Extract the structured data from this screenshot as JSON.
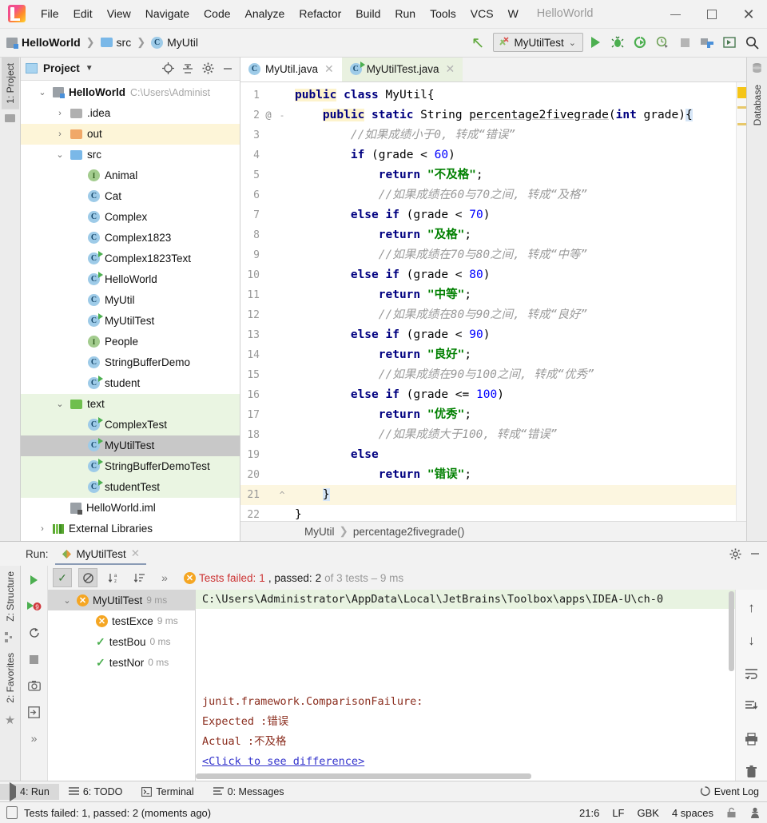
{
  "window": {
    "title": "HelloWorld",
    "minimize_label": "minimize",
    "maximize_label": "maximize",
    "close_label": "close"
  },
  "menubar": {
    "items": [
      "File",
      "Edit",
      "View",
      "Navigate",
      "Code",
      "Analyze",
      "Refactor",
      "Build",
      "Run",
      "Tools",
      "VCS",
      "W"
    ]
  },
  "navbar": {
    "breadcrumb": [
      "HelloWorld",
      "src",
      "MyUtil"
    ],
    "run_config": "MyUtilTest",
    "icons": [
      "back-arrow-icon",
      "run-icon",
      "debug-icon",
      "run-with-coverage-icon",
      "profile-icon",
      "stop-icon",
      "build-project-icon",
      "select-opened-file-icon",
      "search-everywhere-icon"
    ]
  },
  "left_rail": {
    "project_tab": "1: Project",
    "structure_tab": "Z: Structure",
    "favorites_tab": "2: Favorites"
  },
  "right_rail": {
    "database_tab": "Database"
  },
  "project_panel": {
    "title": "Project",
    "toolbar_icons": [
      "locate-icon",
      "collapse-all-icon",
      "gear-icon",
      "hide-icon"
    ],
    "tree": [
      {
        "depth": 0,
        "chev": "v",
        "icon": "project-folder-icon",
        "label": "HelloWorld",
        "bold": true,
        "path": "C:\\Users\\Administ",
        "hl": ""
      },
      {
        "depth": 1,
        "chev": ">",
        "icon": "folder-gray-icon",
        "label": ".idea",
        "bold": false,
        "path": "",
        "hl": ""
      },
      {
        "depth": 1,
        "chev": ">",
        "icon": "folder-orange-icon",
        "label": "out",
        "bold": false,
        "path": "",
        "hl": "yellow"
      },
      {
        "depth": 1,
        "chev": "v",
        "icon": "folder-blue-icon",
        "label": "src",
        "bold": false,
        "path": "",
        "hl": ""
      },
      {
        "depth": 2,
        "chev": "",
        "icon": "interface-icon",
        "label": "Animal",
        "bold": false,
        "path": "",
        "hl": ""
      },
      {
        "depth": 2,
        "chev": "",
        "icon": "class-icon",
        "label": "Cat",
        "bold": false,
        "path": "",
        "hl": ""
      },
      {
        "depth": 2,
        "chev": "",
        "icon": "class-icon",
        "label": "Complex",
        "bold": false,
        "path": "",
        "hl": ""
      },
      {
        "depth": 2,
        "chev": "",
        "icon": "class-icon",
        "label": "Complex1823",
        "bold": false,
        "path": "",
        "hl": ""
      },
      {
        "depth": 2,
        "chev": "",
        "icon": "class-runnable-icon",
        "label": "Complex1823Text",
        "bold": false,
        "path": "",
        "hl": ""
      },
      {
        "depth": 2,
        "chev": "",
        "icon": "class-runnable-icon",
        "label": "HelloWorld",
        "bold": false,
        "path": "",
        "hl": ""
      },
      {
        "depth": 2,
        "chev": "",
        "icon": "class-icon",
        "label": "MyUtil",
        "bold": false,
        "path": "",
        "hl": ""
      },
      {
        "depth": 2,
        "chev": "",
        "icon": "class-runnable-icon",
        "label": "MyUtilTest",
        "bold": false,
        "path": "",
        "hl": ""
      },
      {
        "depth": 2,
        "chev": "",
        "icon": "interface-icon",
        "label": "People",
        "bold": false,
        "path": "",
        "hl": ""
      },
      {
        "depth": 2,
        "chev": "",
        "icon": "class-icon",
        "label": "StringBufferDemo",
        "bold": false,
        "path": "",
        "hl": ""
      },
      {
        "depth": 2,
        "chev": "",
        "icon": "class-runnable-icon",
        "label": "student",
        "bold": false,
        "path": "",
        "hl": ""
      },
      {
        "depth": 1,
        "chev": "v",
        "icon": "folder-green-icon",
        "label": "text",
        "bold": false,
        "path": "",
        "hl": "green"
      },
      {
        "depth": 2,
        "chev": "",
        "icon": "class-test-icon",
        "label": "ComplexTest",
        "bold": false,
        "path": "",
        "hl": "green"
      },
      {
        "depth": 2,
        "chev": "",
        "icon": "class-test-icon",
        "label": "MyUtilTest",
        "bold": false,
        "path": "",
        "hl": "sel"
      },
      {
        "depth": 2,
        "chev": "",
        "icon": "class-test-icon",
        "label": "StringBufferDemoTest",
        "bold": false,
        "path": "",
        "hl": "green"
      },
      {
        "depth": 2,
        "chev": "",
        "icon": "class-test-icon",
        "label": "studentTest",
        "bold": false,
        "path": "",
        "hl": "green"
      },
      {
        "depth": 1,
        "chev": "",
        "icon": "iml-file-icon",
        "label": "HelloWorld.iml",
        "bold": false,
        "path": "",
        "hl": ""
      },
      {
        "depth": 0,
        "chev": ">",
        "icon": "library-icon",
        "label": "External Libraries",
        "bold": false,
        "path": "",
        "hl": ""
      }
    ]
  },
  "editor": {
    "tabs": [
      {
        "label": "MyUtil.java",
        "icon": "class-icon",
        "active": true
      },
      {
        "label": "MyUtilTest.java",
        "icon": "class-test-icon",
        "active": false
      }
    ],
    "breadcrumb": [
      "MyUtil",
      "percentage2fivegrade()"
    ],
    "lines": [
      {
        "n": "1",
        "mark": "",
        "fold": "",
        "cur": false,
        "html": "<span class=\"hl-kw kw\">public</span> <span class=\"kw\">class</span> <span class=\"plain\">MyUtil{</span>"
      },
      {
        "n": "2",
        "mark": "@",
        "fold": "-",
        "cur": false,
        "html": "    <span class=\"hl-kw kw\">public</span> <span class=\"kw\">static</span> <span class=\"plain\">String </span><span class=\"plain ul\">percentage2fivegrade</span><span class=\"plain\">(</span><span class=\"kw\">int</span><span class=\"plain\"> grade)</span><span class=\"brace-hl plain\">{</span>"
      },
      {
        "n": "3",
        "mark": "",
        "fold": "",
        "cur": false,
        "html": "        <span class=\"cmt\">//如果成绩小于0, 转成“错误”</span>"
      },
      {
        "n": "4",
        "mark": "",
        "fold": "",
        "cur": false,
        "html": "        <span class=\"kw\">if</span><span class=\"plain\"> (grade &lt; </span><span class=\"num\">60</span><span class=\"plain\">)</span>"
      },
      {
        "n": "5",
        "mark": "",
        "fold": "",
        "cur": false,
        "html": "            <span class=\"kw\">return</span> <span class=\"str\">\"不及格\"</span><span class=\"plain\">;</span>"
      },
      {
        "n": "6",
        "mark": "",
        "fold": "",
        "cur": false,
        "html": "            <span class=\"cmt\">//如果成绩在60与70之间, 转成“及格”</span>"
      },
      {
        "n": "7",
        "mark": "",
        "fold": "",
        "cur": false,
        "html": "        <span class=\"kw\">else if</span><span class=\"plain\"> (grade &lt; </span><span class=\"num\">70</span><span class=\"plain\">)</span>"
      },
      {
        "n": "8",
        "mark": "",
        "fold": "",
        "cur": false,
        "html": "            <span class=\"kw\">return</span> <span class=\"str\">\"及格\"</span><span class=\"plain\">;</span>"
      },
      {
        "n": "9",
        "mark": "",
        "fold": "",
        "cur": false,
        "html": "            <span class=\"cmt\">//如果成绩在70与80之间, 转成“中等”</span>"
      },
      {
        "n": "10",
        "mark": "",
        "fold": "",
        "cur": false,
        "html": "        <span class=\"kw\">else if</span><span class=\"plain\"> (grade &lt; </span><span class=\"num\">80</span><span class=\"plain\">)</span>"
      },
      {
        "n": "11",
        "mark": "",
        "fold": "",
        "cur": false,
        "html": "            <span class=\"kw\">return</span> <span class=\"str\">\"中等\"</span><span class=\"plain\">;</span>"
      },
      {
        "n": "12",
        "mark": "",
        "fold": "",
        "cur": false,
        "html": "            <span class=\"cmt\">//如果成绩在80与90之间, 转成“良好”</span>"
      },
      {
        "n": "13",
        "mark": "",
        "fold": "",
        "cur": false,
        "html": "        <span class=\"kw\">else if</span><span class=\"plain\"> (grade &lt; </span><span class=\"num\">90</span><span class=\"plain\">)</span>"
      },
      {
        "n": "14",
        "mark": "",
        "fold": "",
        "cur": false,
        "html": "            <span class=\"kw\">return</span> <span class=\"str\">\"良好\"</span><span class=\"plain\">;</span>"
      },
      {
        "n": "15",
        "mark": "",
        "fold": "",
        "cur": false,
        "html": "            <span class=\"cmt\">//如果成绩在90与100之间, 转成“优秀”</span>"
      },
      {
        "n": "16",
        "mark": "",
        "fold": "",
        "cur": false,
        "html": "        <span class=\"kw\">else if</span><span class=\"plain\"> (grade &lt;= </span><span class=\"num\">100</span><span class=\"plain\">)</span>"
      },
      {
        "n": "17",
        "mark": "",
        "fold": "",
        "cur": false,
        "html": "            <span class=\"kw\">return</span> <span class=\"str\">\"优秀\"</span><span class=\"plain\">;</span>"
      },
      {
        "n": "18",
        "mark": "",
        "fold": "",
        "cur": false,
        "html": "            <span class=\"cmt\">//如果成绩大于100, 转成“错误”</span>"
      },
      {
        "n": "19",
        "mark": "",
        "fold": "",
        "cur": false,
        "html": "        <span class=\"kw\">else</span>"
      },
      {
        "n": "20",
        "mark": "",
        "fold": "",
        "cur": false,
        "html": "            <span class=\"kw\">return</span> <span class=\"str\">\"错误\"</span><span class=\"plain\">;</span>"
      },
      {
        "n": "21",
        "mark": "",
        "fold": "^",
        "cur": true,
        "html": "    <span class=\"brace-hl plain\">}</span>"
      },
      {
        "n": "22",
        "mark": "",
        "fold": "",
        "cur": false,
        "html": "<span class=\"plain\">}</span>"
      }
    ]
  },
  "run_panel": {
    "label": "Run:",
    "tab": "MyUtilTest",
    "toolbar_icons": [
      "rerun-icon",
      "rerun-failed-icon",
      "toggle-auto-test-icon",
      "stop-icon",
      "screenshot-icon",
      "export-icon",
      "expand-icon"
    ],
    "topbar_icons": [
      "show-passed-icon",
      "hide-ignored-icon",
      "sort-alphabetically-icon",
      "sort-by-duration-icon",
      "more-icon"
    ],
    "status": {
      "failed_prefix": "Tests failed: ",
      "failed_count": "1",
      "passed_prefix": ", passed: ",
      "passed_count": "2",
      "suffix": " of 3 tests – 9 ms"
    },
    "tests": [
      {
        "name": "MyUtilTest",
        "time": "9 ms",
        "status": "failed",
        "selected": true,
        "depth": 0,
        "chev": "v"
      },
      {
        "name": "testExce",
        "time": "9 ms",
        "status": "failed",
        "selected": false,
        "depth": 1,
        "chev": ""
      },
      {
        "name": "testBou",
        "time": "0 ms",
        "status": "passed",
        "selected": false,
        "depth": 1,
        "chev": ""
      },
      {
        "name": "testNor",
        "time": "0 ms",
        "status": "passed",
        "selected": false,
        "depth": 1,
        "chev": ""
      }
    ],
    "console": {
      "command_path": "C:\\Users\\Administrator\\AppData\\Local\\JetBrains\\Toolbox\\apps\\IDEA-U\\ch-0",
      "exception": "junit.framework.ComparisonFailure:",
      "expected_label": "Expected :",
      "expected_value": "错误",
      "actual_label": "Actual   :",
      "actual_value": "不及格",
      "diff_link": "<Click to see difference>"
    },
    "right_tools": [
      "scroll-up-icon",
      "scroll-down-icon",
      "soft-wrap-icon",
      "scroll-to-end-icon",
      "print-icon",
      "clear-all-icon"
    ]
  },
  "toolwindow_bar": {
    "items": [
      {
        "label": "4: Run",
        "icon": "run-icon",
        "selected": true
      },
      {
        "label": "6: TODO",
        "icon": "todo-icon",
        "selected": false
      },
      {
        "label": "Terminal",
        "icon": "terminal-icon",
        "selected": false
      },
      {
        "label": "0: Messages",
        "icon": "messages-icon",
        "selected": false
      }
    ],
    "event_log": "Event Log"
  },
  "statusbar": {
    "message": "Tests failed: 1, passed: 2 (moments ago)",
    "caret": "21:6",
    "line_sep": "LF",
    "encoding": "GBK",
    "indent": "4 spaces",
    "icons": [
      "lock-icon",
      "inspector-icon"
    ]
  },
  "colors": {
    "accent_green": "#4caf50",
    "fail_red": "#cc3333",
    "warn_orange": "#f5a623",
    "keyword_blue": "#000080",
    "string_green": "#008000"
  }
}
